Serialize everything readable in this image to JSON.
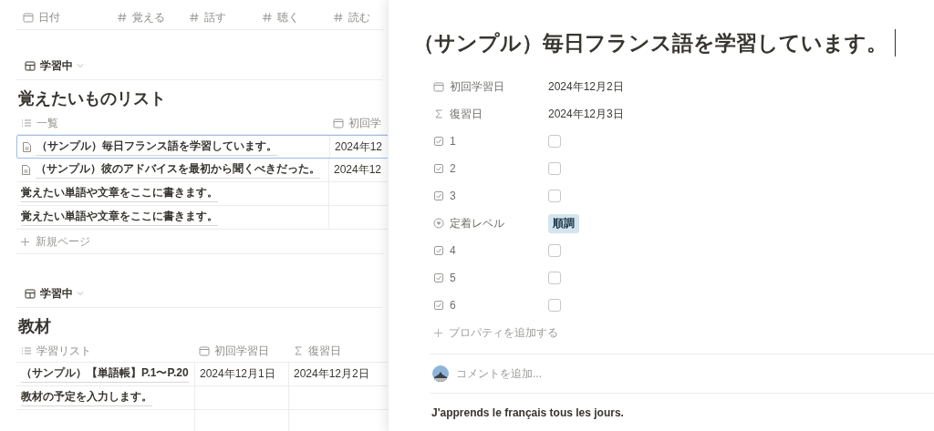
{
  "top_columns": [
    {
      "label": "日付",
      "kind": "date"
    },
    {
      "label": "覚える",
      "kind": "number"
    },
    {
      "label": "話す",
      "kind": "number"
    },
    {
      "label": "聴く",
      "kind": "number"
    },
    {
      "label": "読む",
      "kind": "number"
    }
  ],
  "sections": [
    {
      "view": "学習中",
      "title": "覚えたいものリスト",
      "columns": [
        {
          "label": "一覧",
          "kind": "title"
        },
        {
          "label": "初回学",
          "kind": "date"
        }
      ],
      "rows": [
        {
          "kind": "page",
          "selected": true,
          "cells": [
            "（サンプル）毎日フランス語を学習しています。",
            "2024年12"
          ]
        },
        {
          "kind": "page",
          "selected": false,
          "cells": [
            "（サンプル）彼のアドバイスを最初から聞くべきだった。",
            "2024年12"
          ]
        },
        {
          "kind": "plain",
          "selected": false,
          "cells": [
            "覚えたい単語や文章をここに書きます。",
            ""
          ]
        },
        {
          "kind": "plain",
          "selected": false,
          "cells": [
            "覚えたい単語や文章をここに書きます。",
            ""
          ]
        }
      ],
      "new_page": "新規ページ"
    },
    {
      "view": "学習中",
      "title": "教材",
      "columns": [
        {
          "label": "学習リスト",
          "kind": "title"
        },
        {
          "label": "初回学習日",
          "kind": "date"
        },
        {
          "label": "復習日",
          "kind": "formula"
        }
      ],
      "rows": [
        {
          "kind": "plain",
          "selected": false,
          "cells": [
            "（サンプル）【単語帳】P.1〜P.20",
            "2024年12月1日",
            "2024年12月2日"
          ]
        },
        {
          "kind": "plain",
          "selected": false,
          "cells": [
            "教材の予定を入力します。",
            "",
            ""
          ]
        },
        {
          "kind": "plain",
          "selected": false,
          "cells": [
            "",
            "",
            ""
          ]
        }
      ]
    }
  ],
  "panel": {
    "title": "（サンプル）毎日フランス語を学習しています。",
    "properties": [
      {
        "kind": "date",
        "label": "初回学習日",
        "value": "2024年12月2日"
      },
      {
        "kind": "formula",
        "label": "復習日",
        "value": "2024年12月3日"
      },
      {
        "kind": "checkbox",
        "label": "1",
        "checked": false
      },
      {
        "kind": "checkbox",
        "label": "2",
        "checked": false
      },
      {
        "kind": "checkbox",
        "label": "3",
        "checked": false
      },
      {
        "kind": "select",
        "label": "定着レベル",
        "value": "順調"
      },
      {
        "kind": "checkbox",
        "label": "4",
        "checked": false
      },
      {
        "kind": "checkbox",
        "label": "5",
        "checked": false
      },
      {
        "kind": "checkbox",
        "label": "6",
        "checked": false
      }
    ],
    "add_property": "プロパティを追加する",
    "comment_placeholder": "コメントを追加...",
    "body": "J'apprends le français tous les jours."
  }
}
